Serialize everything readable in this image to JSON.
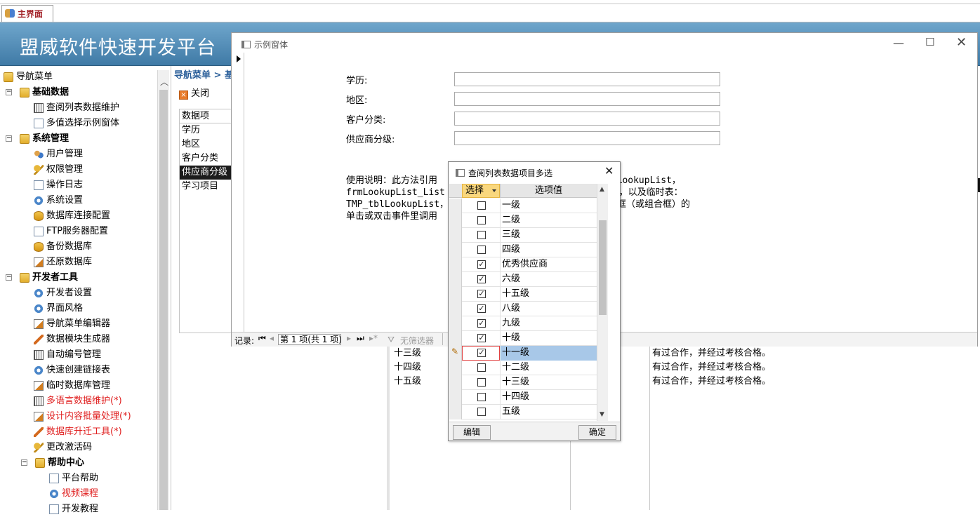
{
  "app": {
    "main_tab": "主界面",
    "banner_title": "盟威软件快速开发平台"
  },
  "nav": {
    "root": "导航菜单",
    "items": [
      {
        "label": "基础数据",
        "bold": true
      },
      {
        "label": "查阅列表数据维护"
      },
      {
        "label": "多值选择示例窗体"
      },
      {
        "label": "系统管理",
        "bold": true
      },
      {
        "label": "用户管理"
      },
      {
        "label": "权限管理"
      },
      {
        "label": "操作日志"
      },
      {
        "label": "系统设置"
      },
      {
        "label": "数据库连接配置"
      },
      {
        "label": "FTP服务器配置"
      },
      {
        "label": "备份数据库"
      },
      {
        "label": "还原数据库"
      },
      {
        "label": "开发者工具",
        "bold": true
      },
      {
        "label": "开发者设置"
      },
      {
        "label": "界面风格"
      },
      {
        "label": "导航菜单编辑器"
      },
      {
        "label": "数据模块生成器"
      },
      {
        "label": "自动编号管理"
      },
      {
        "label": "快速创建链接表"
      },
      {
        "label": "临时数据库管理"
      },
      {
        "label": "多语言数据维护(*)"
      },
      {
        "label": "设计内容批量处理(*)"
      },
      {
        "label": "数据库升迁工具(*)"
      },
      {
        "label": "更改激活码"
      },
      {
        "label": "帮助中心",
        "bold": true
      },
      {
        "label": "平台帮助"
      },
      {
        "label": "视频课程"
      },
      {
        "label": "开发教程"
      }
    ]
  },
  "content": {
    "breadcrumb": "导航菜单 > 基",
    "close_label": "关闭",
    "list_header": "数据项",
    "list_items": [
      "学历",
      "地区",
      "客户分类",
      "供应商分级",
      "学习项目"
    ],
    "bg_rows": [
      {
        "name": "十三级",
        "desc": "有过合作，并经过考核合格。"
      },
      {
        "name": "十四级",
        "desc": "有过合作，并经过考核合格。"
      },
      {
        "name": "十五级",
        "desc": "有过合作，并经过考核合格。"
      }
    ]
  },
  "form": {
    "title": "示例窗体",
    "fields": [
      {
        "label": "学历:",
        "value": ""
      },
      {
        "label": "地区:",
        "value": ""
      },
      {
        "label": "客户分类:",
        "value": ""
      },
      {
        "label": "供应商分级:",
        "value": ""
      }
    ],
    "usage_lines": [
      "使用说明：此方法引用                            ：frmLookupList，",
      "frmLookupList_List                              择，以及临时表：",
      "TMP_tblLookupList，                             本框（或组合框）的",
      "单击或双击事件里调用"
    ],
    "nav": {
      "record_label": "记录:",
      "record_value": "第 1 项(共 1 项)",
      "filter_label": "无筛选器"
    }
  },
  "popup": {
    "title": "查阅列表数据项目多选",
    "col_select": "选择",
    "col_value": "选项值",
    "rows": [
      {
        "value": "一级",
        "checked": false
      },
      {
        "value": "二级",
        "checked": false
      },
      {
        "value": "三级",
        "checked": false
      },
      {
        "value": "四级",
        "checked": false
      },
      {
        "value": "优秀供应商",
        "checked": true
      },
      {
        "value": "六级",
        "checked": true
      },
      {
        "value": "十五级",
        "checked": true
      },
      {
        "value": "八级",
        "checked": true
      },
      {
        "value": "九级",
        "checked": true
      },
      {
        "value": "十级",
        "checked": true
      },
      {
        "value": "十一级",
        "checked": true,
        "current": true
      },
      {
        "value": "十二级",
        "checked": false
      },
      {
        "value": "十三级",
        "checked": false
      },
      {
        "value": "十四级",
        "checked": false
      },
      {
        "value": "五级",
        "checked": false
      }
    ],
    "edit_label": "编辑",
    "ok_label": "确定"
  },
  "colors": {
    "banner": "#4f8cb8",
    "selected_row": "#a8c8e8",
    "header_highlight": "#f9d77e",
    "red_text": "#e02020"
  }
}
